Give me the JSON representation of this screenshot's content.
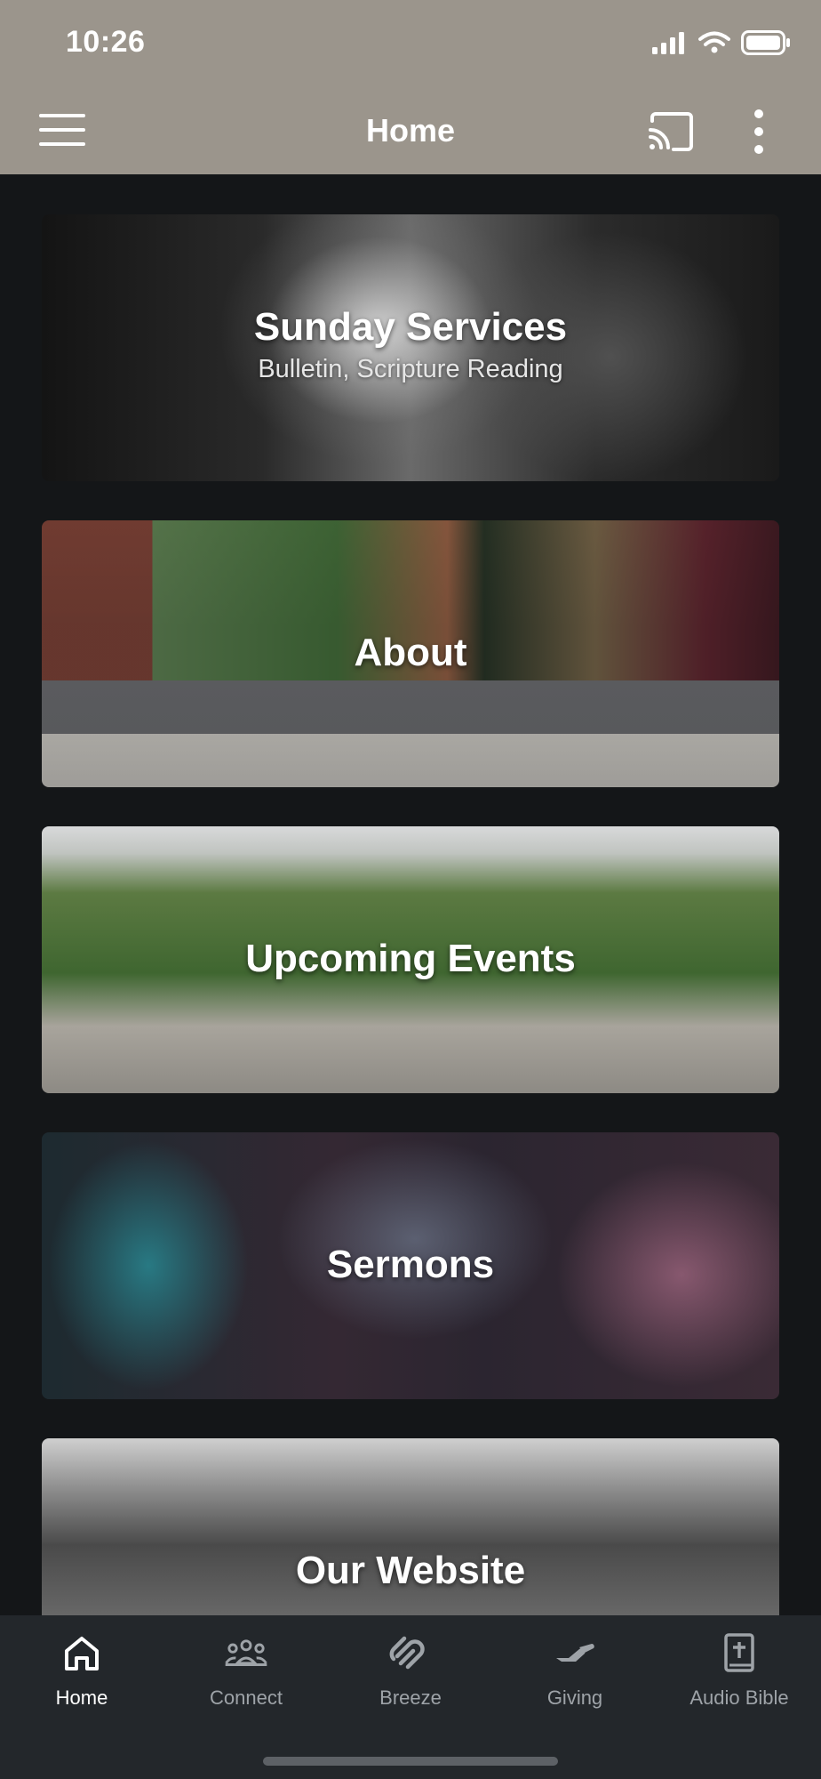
{
  "status_bar": {
    "time": "10:26"
  },
  "header": {
    "title": "Home"
  },
  "cards": [
    {
      "title": "Sunday Services",
      "subtitle": "Bulletin, Scripture Reading"
    },
    {
      "title": "About"
    },
    {
      "title": "Upcoming Events"
    },
    {
      "title": "Sermons"
    },
    {
      "title": "Our Website"
    }
  ],
  "tabs": [
    {
      "label": "Home",
      "icon": "home-icon",
      "active": true
    },
    {
      "label": "Connect",
      "icon": "group-icon",
      "active": false
    },
    {
      "label": "Breeze",
      "icon": "breeze-icon",
      "active": false
    },
    {
      "label": "Giving",
      "icon": "giving-icon",
      "active": false
    },
    {
      "label": "Audio Bible",
      "icon": "bible-icon",
      "active": false
    }
  ],
  "colors": {
    "header_bg": "#9b958c",
    "page_bg": "#141618",
    "tabbar_bg": "#23272b",
    "tab_active": "#ffffff",
    "tab_inactive": "#9ea3a8"
  }
}
